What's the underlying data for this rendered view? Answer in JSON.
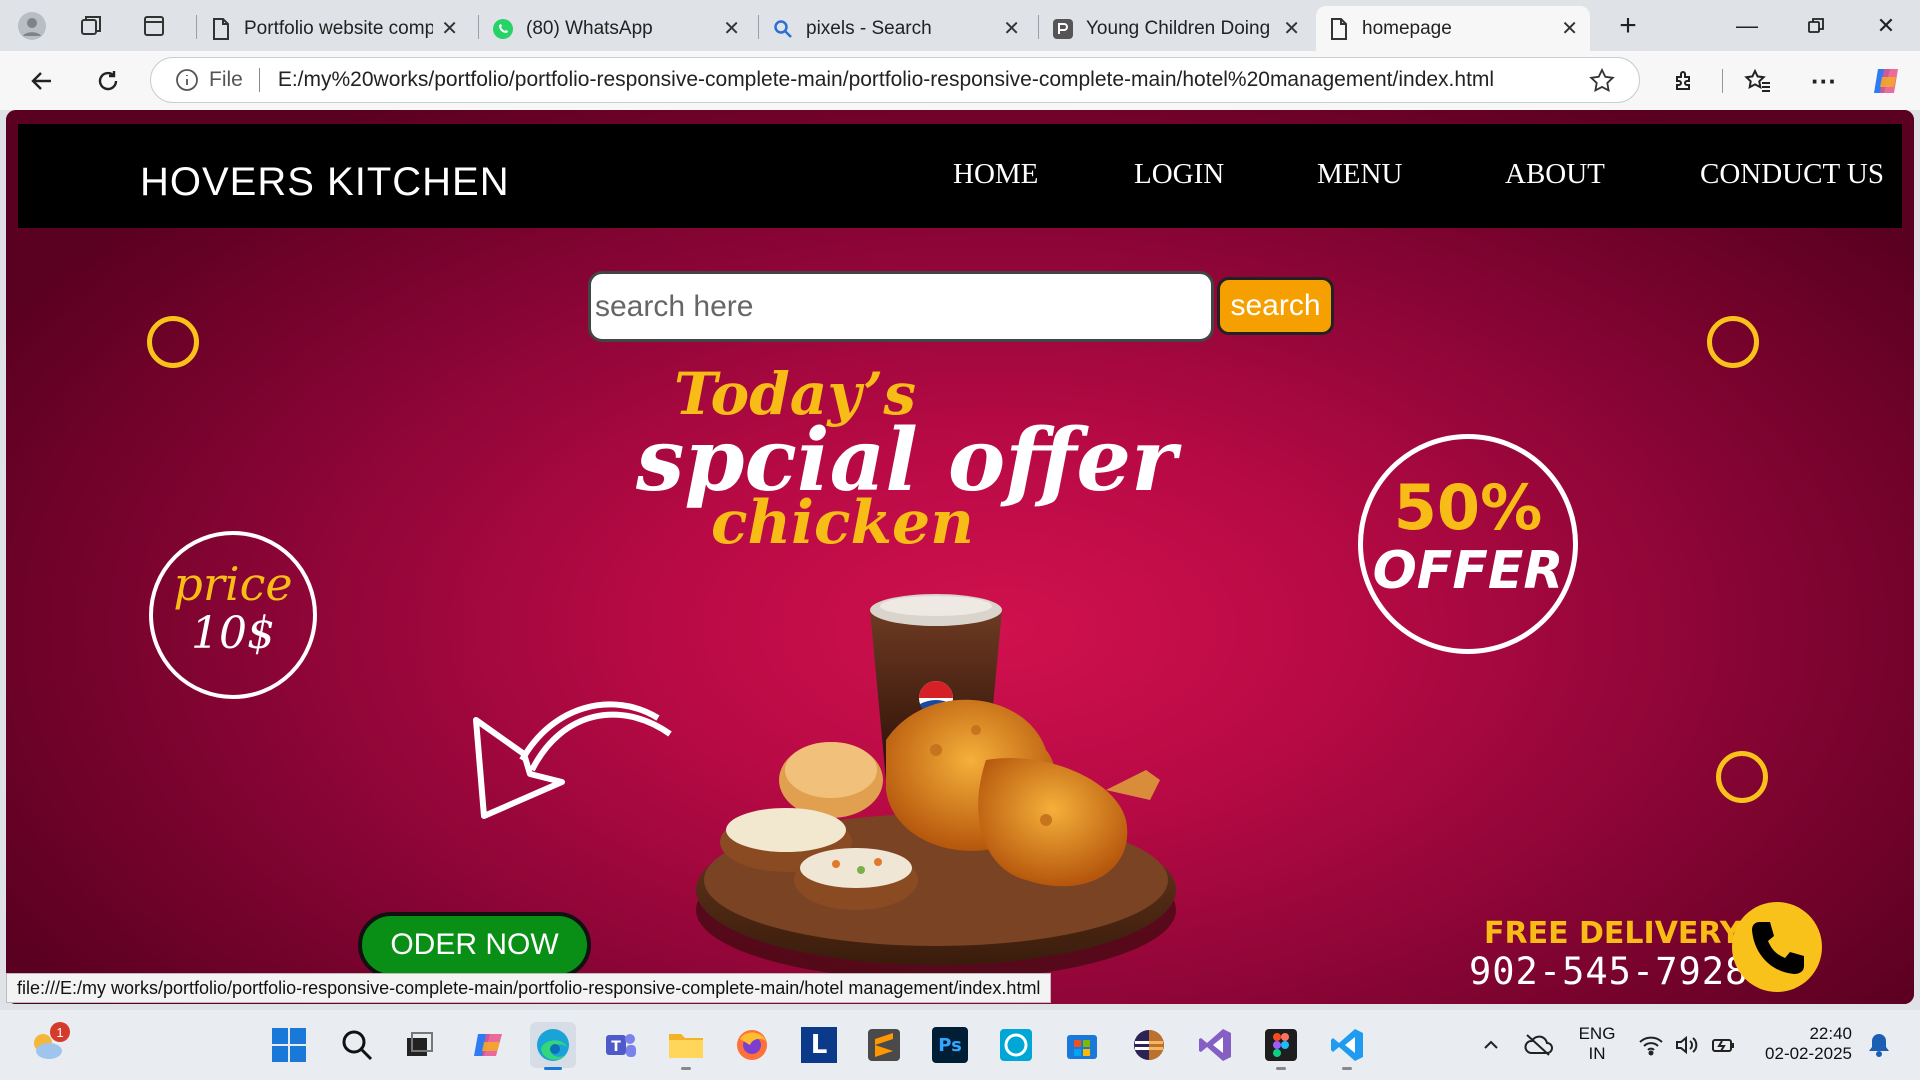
{
  "browser": {
    "tabs": [
      {
        "title": "Portfolio website compl",
        "icon": "page-icon"
      },
      {
        "title": "(80) WhatsApp",
        "icon": "whatsapp-icon"
      },
      {
        "title": "pixels - Search",
        "icon": "search-icon"
      },
      {
        "title": "Young Children Doing F",
        "icon": "pexels-icon"
      },
      {
        "title": "homepage",
        "icon": "page-icon"
      }
    ],
    "address": {
      "scheme_label": "File",
      "url": "E:/my%20works/portfolio/portfolio-responsive-complete-main/portfolio-responsive-complete-main/hotel%20management/index.html"
    }
  },
  "page": {
    "brand": "HOVERS KITCHEN",
    "nav": [
      "HOME",
      "LOGIN",
      "MENU",
      "ABOUT",
      "CONDUCT US"
    ],
    "search": {
      "placeholder": "search here",
      "button": "search"
    },
    "headline": {
      "line1": "Today’s",
      "line2": "spcial offer",
      "line3": "chicken"
    },
    "price_badge": {
      "line1": "price",
      "line2": "10$"
    },
    "offer_badge": {
      "line1": "50%",
      "line2": "OFFER"
    },
    "order_button": "ODER NOW",
    "delivery": {
      "label": "FREE DELIVERY",
      "phone": "902-545-7928"
    },
    "drink_label": "pepsi"
  },
  "status_url": "file:///E:/my works/portfolio/portfolio-responsive-complete-main/portfolio-responsive-complete-main/hotel management/index.html",
  "taskbar": {
    "weather_badge": "1",
    "language": {
      "line1": "ENG",
      "line2": "IN"
    },
    "clock": {
      "time": "22:40",
      "date": "02-02-2025"
    },
    "app_letter_l": "L",
    "app_letter_ps": "Ps"
  },
  "colors": {
    "accent_yellow": "#f7bd16",
    "hero_pink": "#c8104b",
    "order_green": "#0a8f16",
    "search_orange": "#f5a000"
  }
}
